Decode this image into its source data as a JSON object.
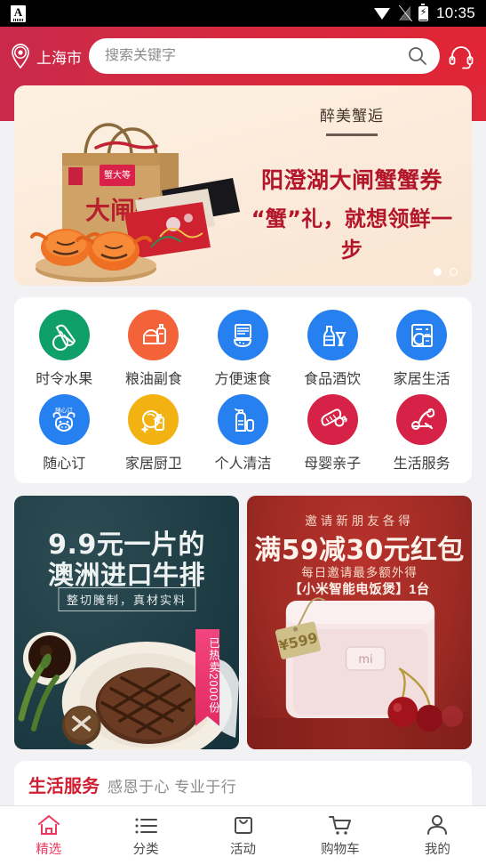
{
  "statusbar": {
    "notification_icon": "letter-a-icon",
    "wifi_icon": "wifi-icon",
    "signal_icon": "signal-off-icon",
    "battery_icon": "battery-charging-icon",
    "time": "10:35"
  },
  "header": {
    "location_icon": "location-pin-icon",
    "location": "上海市",
    "search_placeholder": "搜索关键字",
    "search_value": "",
    "search_icon": "search-icon",
    "support_icon": "headset-icon",
    "bg_color": "#d32a42"
  },
  "banner": {
    "kicker": "醉美蟹逅",
    "headline": "阳澄湖大闸蟹蟹券",
    "subheadline": "“蟹”礼，就想领鲜一步",
    "box_label": "大闸蟹",
    "brand_label": "蟹大等",
    "accent_color": "#b3152b",
    "bg_color": "#fbeada",
    "dots": [
      {
        "active": true
      },
      {
        "active": false
      }
    ]
  },
  "categories": [
    {
      "label": "时令水果",
      "icon": "vegetable-icon",
      "color": "#0fa06a"
    },
    {
      "label": "粮油副食",
      "icon": "oil-grain-icon",
      "color": "#f4623a"
    },
    {
      "label": "方便速食",
      "icon": "instant-food-icon",
      "color": "#2780f0"
    },
    {
      "label": "食品酒饮",
      "icon": "drinks-icon",
      "color": "#2780f0"
    },
    {
      "label": "家居生活",
      "icon": "home-appliance-icon",
      "color": "#2780f0"
    },
    {
      "label": "随心订",
      "icon": "cow-subscription-icon",
      "color": "#2780f0"
    },
    {
      "label": "家居厨卫",
      "icon": "cleaning-spray-icon",
      "color": "#f2b211"
    },
    {
      "label": "个人清洁",
      "icon": "personal-care-icon",
      "color": "#2780f0"
    },
    {
      "label": "母婴亲子",
      "icon": "baby-bottle-icon",
      "color": "#d62246"
    },
    {
      "label": "生活服务",
      "icon": "faucet-repair-icon",
      "color": "#d62246"
    }
  ],
  "promos": [
    {
      "title_line1": "9.9元一片的",
      "title_line2": "澳洲进口牛排",
      "subtitle": "整切腌制，真材实料",
      "ribbon": "已热卖2000份",
      "bg_color": "#1e3c44"
    },
    {
      "eyebrow": "邀请新朋友各得",
      "title": "满59减30元红包",
      "note_line1": "每日邀请最多额外得",
      "note_line2": "【小米智能电饭煲】1台",
      "price_tag": "¥599",
      "bg_color": "#9e2a24"
    }
  ],
  "service_section": {
    "title": "生活服务",
    "subtitle": "感恩于心 专业于行",
    "title_color": "#cf1f33"
  },
  "tabbar": {
    "active_color": "#ec3a5f",
    "items": [
      {
        "label": "精选",
        "icon": "home-icon",
        "active": true
      },
      {
        "label": "分类",
        "icon": "list-icon",
        "active": false
      },
      {
        "label": "活动",
        "icon": "bag-icon",
        "active": false
      },
      {
        "label": "购物车",
        "icon": "cart-icon",
        "active": false
      },
      {
        "label": "我的",
        "icon": "user-icon",
        "active": false
      }
    ]
  }
}
